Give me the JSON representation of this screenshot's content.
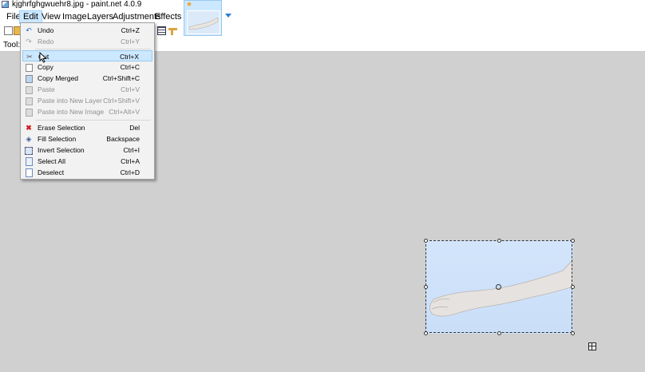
{
  "window": {
    "title": "kjghrfghgwuehr8.jpg - paint.net 4.0.9"
  },
  "menubar": {
    "items": [
      {
        "label": "File"
      },
      {
        "label": "Edit"
      },
      {
        "label": "View"
      },
      {
        "label": "Image"
      },
      {
        "label": "Layers"
      },
      {
        "label": "Adjustments"
      },
      {
        "label": "Effects"
      }
    ],
    "open_item": "Edit"
  },
  "toolbar2": {
    "tools_label": "Tool:"
  },
  "edit_menu": {
    "items": [
      {
        "label": "Undo",
        "shortcut": "Ctrl+Z",
        "icon": "undo-icon",
        "enabled": true
      },
      {
        "label": "Redo",
        "shortcut": "Ctrl+Y",
        "icon": "redo-icon",
        "enabled": false
      },
      {
        "label": "Cut",
        "shortcut": "Ctrl+X",
        "icon": "scissors-icon",
        "enabled": true,
        "hovered": true
      },
      {
        "label": "Copy",
        "shortcut": "Ctrl+C",
        "icon": "copy-icon",
        "enabled": true
      },
      {
        "label": "Copy Merged",
        "shortcut": "Ctrl+Shift+C",
        "icon": "copy-merged-icon",
        "enabled": true
      },
      {
        "label": "Paste",
        "shortcut": "Ctrl+V",
        "icon": "paste-icon",
        "enabled": false
      },
      {
        "label": "Paste into New Layer",
        "shortcut": "Ctrl+Shift+V",
        "icon": "paste-layer-icon",
        "enabled": false
      },
      {
        "label": "Paste into New Image",
        "shortcut": "Ctrl+Alt+V",
        "icon": "paste-image-icon",
        "enabled": false
      },
      {
        "label": "Erase Selection",
        "shortcut": "Del",
        "icon": "erase-icon",
        "enabled": true
      },
      {
        "label": "Fill Selection",
        "shortcut": "Backspace",
        "icon": "fill-bucket-icon",
        "enabled": true
      },
      {
        "label": "Invert Selection",
        "shortcut": "Ctrl+I",
        "icon": "invert-selection-icon",
        "enabled": true
      },
      {
        "label": "Select All",
        "shortcut": "Ctrl+A",
        "icon": "select-all-icon",
        "enabled": true
      },
      {
        "label": "Deselect",
        "shortcut": "Ctrl+D",
        "icon": "deselect-icon",
        "enabled": true
      }
    ]
  },
  "colors": {
    "menu_highlight": "#cce8ff",
    "canvas_bg": "#d0d0d0",
    "image_bg": "#cfe1f9",
    "erase_red": "#d02020"
  }
}
